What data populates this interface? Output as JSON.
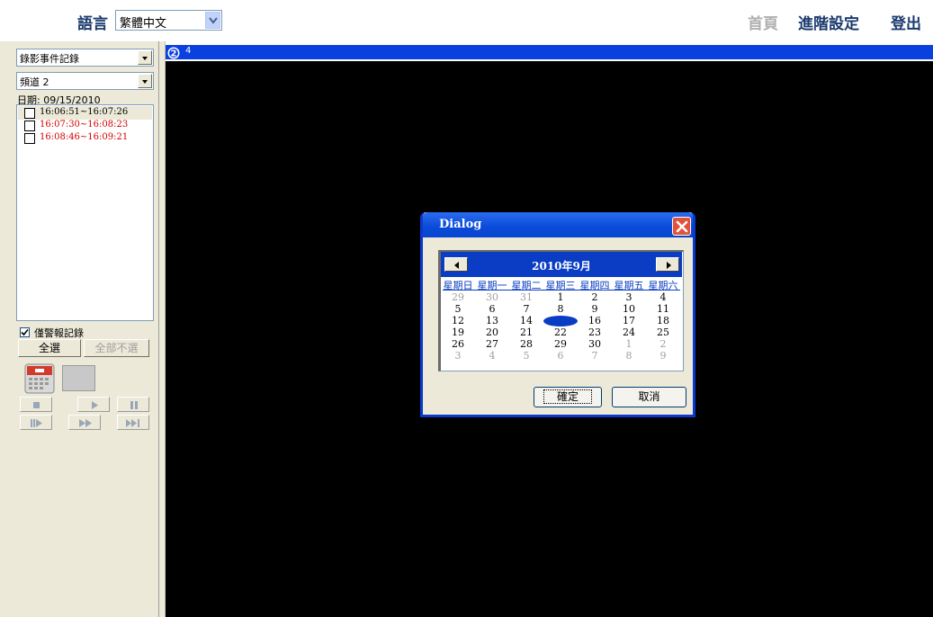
{
  "header": {
    "language_label": "語言",
    "language_value": "繁體中文",
    "nav": {
      "home": "首頁",
      "advanced": "進階設定",
      "logout": "登出"
    }
  },
  "sidebar": {
    "event_type": "錄影事件記錄",
    "channel": "頻道 2",
    "date_label": "日期: 09/15/2010",
    "records": [
      {
        "time": "16:06:51~16:07:26",
        "color": "#000000"
      },
      {
        "time": "16:07:30~16:08:23",
        "color": "#d40000"
      },
      {
        "time": "16:08:46~16:09:21",
        "color": "#d40000"
      }
    ],
    "alarm_only_label": "僅警報記錄",
    "alarm_only_checked": true,
    "select_all": "全選",
    "deselect_all": "全部不選"
  },
  "channel_tab": {
    "badge": "2",
    "label": "4"
  },
  "dialog": {
    "title": "Dialog",
    "calendar": {
      "month_label": "2010年9月",
      "weekdays": [
        "星期日",
        "星期一",
        "星期二",
        "星期三",
        "星期四",
        "星期五",
        "星期六"
      ],
      "weeks": [
        [
          "29",
          "30",
          "31",
          "1",
          "2",
          "3",
          "4"
        ],
        [
          "5",
          "6",
          "7",
          "8",
          "9",
          "10",
          "11"
        ],
        [
          "12",
          "13",
          "14",
          "15",
          "16",
          "17",
          "18"
        ],
        [
          "19",
          "20",
          "21",
          "22",
          "23",
          "24",
          "25"
        ],
        [
          "26",
          "27",
          "28",
          "29",
          "30",
          "1",
          "2"
        ],
        [
          "3",
          "4",
          "5",
          "6",
          "7",
          "8",
          "9"
        ]
      ],
      "selected_day": "15"
    },
    "ok": "確定",
    "cancel": "取消"
  }
}
